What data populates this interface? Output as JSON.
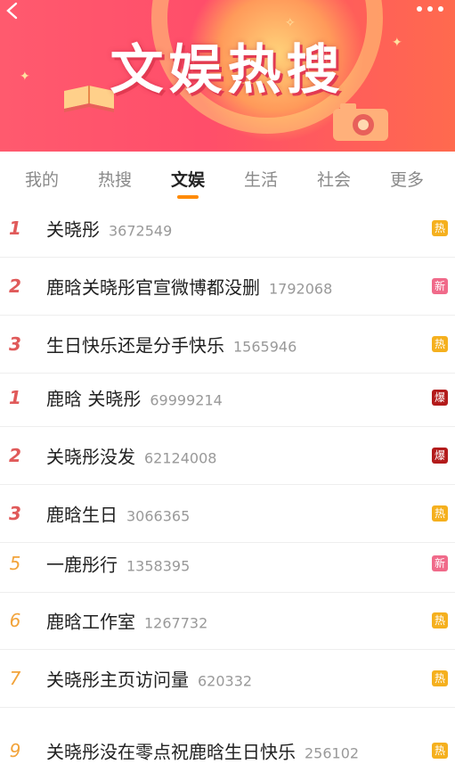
{
  "banner": {
    "title": "文娱热搜"
  },
  "tabs": [
    {
      "label": "我的"
    },
    {
      "label": "热搜"
    },
    {
      "label": "文娱"
    },
    {
      "label": "生活"
    },
    {
      "label": "社会"
    },
    {
      "label": "更多"
    }
  ],
  "active_tab": "文娱",
  "colors": {
    "hot_badge": "#f5b01e",
    "new_badge": "#f06a8a",
    "boom_badge": "#b31b1b",
    "accent": "#ff8a00"
  },
  "items": [
    {
      "rank": "1",
      "title": "关晓彤",
      "count": "3672549",
      "badge": "热"
    },
    {
      "rank": "2",
      "title": "鹿晗关晓彤官宣微博都没删",
      "count": "1792068",
      "badge": "新"
    },
    {
      "rank": "3",
      "title": "生日快乐还是分手快乐",
      "count": "1565946",
      "badge": "热"
    },
    {
      "rank": "1",
      "title": "鹿晗 关晓彤",
      "count": "69999214",
      "badge": "爆"
    },
    {
      "rank": "2",
      "title": "关晓彤没发",
      "count": "62124008",
      "badge": "爆"
    },
    {
      "rank": "3",
      "title": "鹿晗生日",
      "count": "3066365",
      "badge": "热"
    },
    {
      "rank": "5",
      "title": "一鹿彤行",
      "count": "1358395",
      "badge": "新"
    },
    {
      "rank": "6",
      "title": "鹿晗工作室",
      "count": "1267732",
      "badge": "热"
    },
    {
      "rank": "7",
      "title": "关晓彤主页访问量",
      "count": "620332",
      "badge": "热"
    },
    {
      "rank": "9",
      "title": "关晓彤没在零点祝鹿晗生日快乐",
      "count": "256102",
      "badge": "热"
    }
  ]
}
